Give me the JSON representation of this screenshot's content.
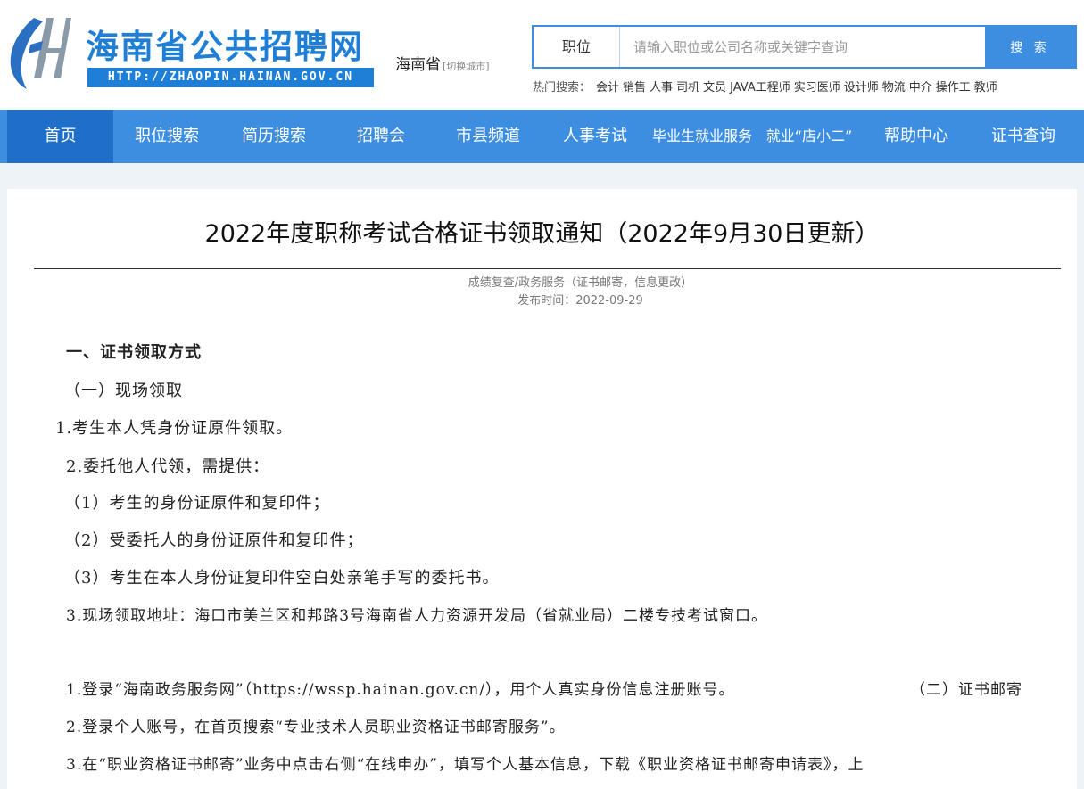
{
  "header": {
    "site_title": "海南省公共招聘网",
    "site_url": "HTTP://ZHAOPIN.HAINAN.GOV.CN",
    "region": "海南省",
    "region_switch": "[切换城市]",
    "brand_color": "#1f7fd7"
  },
  "search": {
    "type_label": "职位",
    "placeholder": "请输入职位或公司名称或关键字查询",
    "value": "",
    "button_label": "搜 索"
  },
  "hot_search": {
    "label": "热门搜索：",
    "items": [
      "会计",
      "销售",
      "人事",
      "司机",
      "文员",
      "JAVA工程师",
      "实习医师",
      "设计师",
      "物流",
      "中介",
      "操作工",
      "教师"
    ]
  },
  "nav": {
    "items": [
      {
        "label": "首页"
      },
      {
        "label": "职位搜索"
      },
      {
        "label": "简历搜索"
      },
      {
        "label": "招聘会"
      },
      {
        "label": "市县频道"
      },
      {
        "label": "人事考试"
      },
      {
        "label": "毕业生就业服务"
      },
      {
        "label": "就业“店小二”"
      },
      {
        "label": "帮助中心"
      },
      {
        "label": "证书查询"
      }
    ],
    "active_index": 0,
    "color": "#3d8ee0",
    "active_color": "#1f6fc9"
  },
  "article": {
    "title": "2022年度职称考试合格证书领取通知（2022年9月30日更新）",
    "category": "成绩复查/政务服务（证书邮寄，信息更改）",
    "publish_label": "发布时间：",
    "publish_date": "2022-09-29",
    "paragraphs": [
      "一、证书领取方式",
      "（一）现场领取",
      "1.考生本人凭身份证原件领取。",
      "2.委托他人代领，需提供：",
      "（1）考生的身份证原件和复印件；",
      "（2）受委托人的身份证原件和复印件；",
      "（3）考生在本人身份证复印件空白处亲笔手写的委托书。",
      "3.现场领取地址：海口市美兰区和邦路3号海南省人力资源开发局（省就业局）二楼专技考试窗口。",
      "1.登录“海南政务服务网”（https://wssp.hainan.gov.cn/），用个人真实身份信息注册账号。",
      "2.登录个人账号，在首页搜索“专业技术人员职业资格证书邮寄服务”。",
      "3.在“职业资格证书邮寄”业务中点击右侧“在线申办”，填写个人基本信息，下载《职业资格证书邮寄申请表》，上"
    ],
    "section_mail": "（二）证书邮寄"
  }
}
